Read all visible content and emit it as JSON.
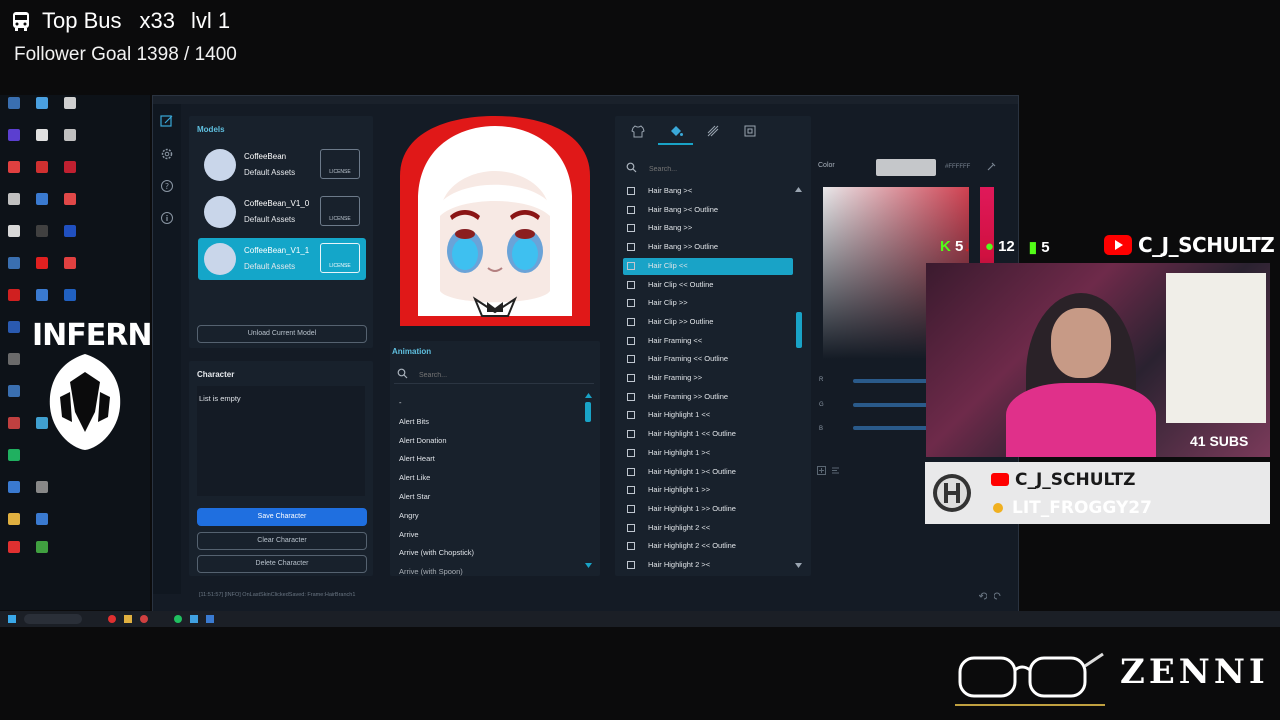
{
  "overlay": {
    "top_bus": "Top Bus",
    "multiplier": "x33",
    "level": "lvl 1",
    "follower_goal": "Follower Goal 1398 / 1400",
    "stat_k": "5",
    "stat_followers": "12",
    "stat_bars": "5",
    "yt_channel": "C_J_SCHULTZ",
    "subs": "41 SUBS",
    "card_channel": "C_J_SCHULTZ",
    "card_user": "LIT_FROGGY27",
    "inferno": "INFERNO",
    "sponsor": "ZENNI"
  },
  "app": {
    "models_title": "Models",
    "models": [
      {
        "name": "CoffeeBean",
        "sub": "Default Assets",
        "license": "LICENSE"
      },
      {
        "name": "CoffeeBean_V1_0",
        "sub": "Default Assets",
        "license": "LICENSE"
      },
      {
        "name": "CoffeeBean_V1_1",
        "sub": "Default Assets",
        "license": "LICENSE"
      }
    ],
    "unload_button": "Unload Current Model",
    "character_title": "Character",
    "list_empty": "List is empty",
    "save_button": "Save Character",
    "clear_button": "Clear Character",
    "delete_button": "Delete Character",
    "animation_title": "Animation",
    "anim_search_placeholder": "Search...",
    "animations": [
      "-",
      "Alert Bits",
      "Alert Donation",
      "Alert Heart",
      "Alert Like",
      "Alert Star",
      "Angry",
      "Arrive",
      "Arrive (with Chopstick)",
      "Arrive (with Spoon)"
    ],
    "parts_search_placeholder": "Search...",
    "parts": [
      "Hair Bang ><",
      "Hair Bang >< Outline",
      "Hair Bang >>",
      "Hair Bang >> Outline",
      "Hair Clip <<",
      "Hair Clip << Outline",
      "Hair Clip >>",
      "Hair Clip >> Outline",
      "Hair Framing <<",
      "Hair Framing << Outline",
      "Hair Framing >>",
      "Hair Framing >> Outline",
      "Hair Highlight 1 <<",
      "Hair Highlight 1 << Outline",
      "Hair Highlight 1 ><",
      "Hair Highlight 1 >< Outline",
      "Hair Highlight 1 >>",
      "Hair Highlight 1 >> Outline",
      "Hair Highlight 2 <<",
      "Hair Highlight 2 << Outline",
      "Hair Highlight 2 ><"
    ],
    "selected_part_index": 4,
    "color_label": "Color",
    "color_hex": "#FFFFFF",
    "r_label": "R",
    "g_label": "G",
    "b_label": "B",
    "status_log": "[11:51:57] [INFO] OnLastSkinClickedSaved: Frame:HairBranch1"
  },
  "colors": {
    "accent": "#19a3c7",
    "primary_button": "#1f6fe0",
    "window_bg": "#141b25"
  }
}
